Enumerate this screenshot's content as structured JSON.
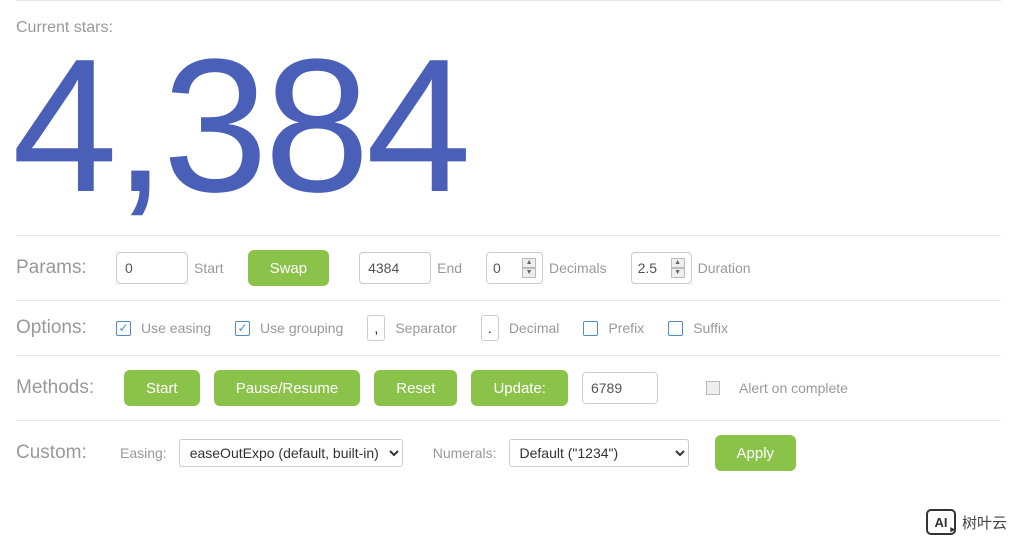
{
  "current_label": "Current stars:",
  "current_value": "4,384",
  "params": {
    "section_label": "Params:",
    "start_value": "0",
    "start_label": "Start",
    "swap_label": "Swap",
    "end_value": "4384",
    "end_label": "End",
    "decimals_value": "0",
    "decimals_label": "Decimals",
    "duration_value": "2.5",
    "duration_label": "Duration"
  },
  "options": {
    "section_label": "Options:",
    "use_easing": {
      "checked": true,
      "label": "Use easing"
    },
    "use_grouping": {
      "checked": true,
      "label": "Use grouping"
    },
    "separator": {
      "value": ",",
      "label": "Separator"
    },
    "decimal": {
      "value": ".",
      "label": "Decimal"
    },
    "prefix": {
      "value": "",
      "label": "Prefix"
    },
    "suffix": {
      "value": "",
      "label": "Suffix"
    }
  },
  "methods": {
    "section_label": "Methods:",
    "start_label": "Start",
    "pause_resume_label": "Pause/Resume",
    "reset_label": "Reset",
    "update_label": "Update:",
    "update_value": "6789",
    "alert_checked": false,
    "alert_label": "Alert on complete"
  },
  "custom": {
    "section_label": "Custom:",
    "easing_label": "Easing:",
    "easing_value": "easeOutExpo (default, built-in)",
    "numerals_label": "Numerals:",
    "numerals_value": "Default (\"1234\")",
    "apply_label": "Apply"
  },
  "brand": "树叶云"
}
